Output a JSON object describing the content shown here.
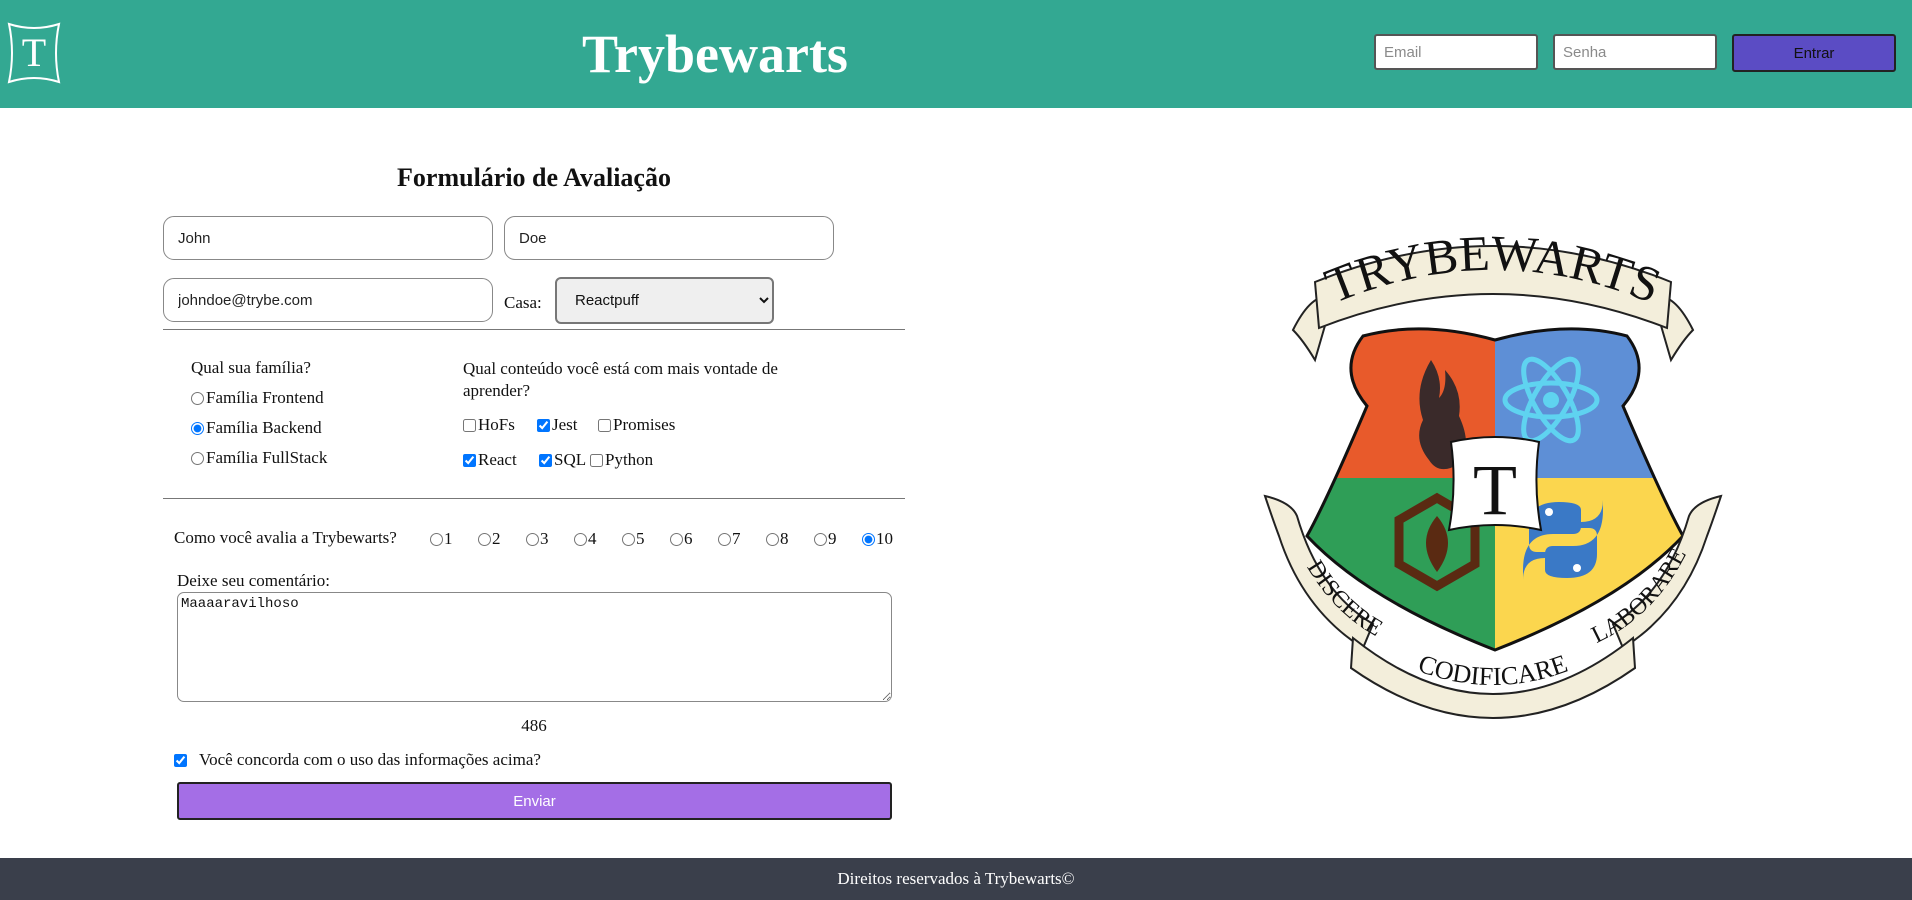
{
  "header": {
    "logo_letter": "T",
    "title": "Trybewarts",
    "email_placeholder": "Email",
    "password_placeholder": "Senha",
    "login_label": "Entrar"
  },
  "form": {
    "title": "Formulário de Avaliação",
    "first_name": "John",
    "last_name": "Doe",
    "email": "johndoe@trybe.com",
    "house_label": "Casa:",
    "house_selected": "Reactpuff",
    "family": {
      "question": "Qual sua família?",
      "options": [
        {
          "label": "Família Frontend",
          "checked": false
        },
        {
          "label": "Família Backend",
          "checked": true
        },
        {
          "label": "Família FullStack",
          "checked": false
        }
      ]
    },
    "content": {
      "question": "Qual conteúdo você está com mais vontade de aprender?",
      "options": [
        {
          "label": "HoFs",
          "checked": false
        },
        {
          "label": "Jest",
          "checked": true
        },
        {
          "label": "Promises",
          "checked": false
        },
        {
          "label": "React",
          "checked": true
        },
        {
          "label": "SQL",
          "checked": true
        },
        {
          "label": "Python",
          "checked": false
        }
      ]
    },
    "rating": {
      "question": "Como você avalia a Trybewarts?",
      "options": [
        "1",
        "2",
        "3",
        "4",
        "5",
        "6",
        "7",
        "8",
        "9",
        "10"
      ],
      "selected": "10"
    },
    "comment_label": "Deixe seu comentário:",
    "comment": "Maaaaravilhoso",
    "char_counter": "486",
    "agreement_label": "Você concorda com o uso das informações acima?",
    "agreement_checked": true,
    "submit_label": "Enviar"
  },
  "crest": {
    "banner_top": "TRYBEWARTS",
    "center_letter": "T",
    "motto_left": "DISCERE",
    "motto_bottom": "CODIFICARE",
    "motto_right": "LABORARE",
    "quarters": {
      "top_left": "fire-icon",
      "top_right": "react-atom-icon",
      "bottom_left": "hexagon-leaf-icon",
      "bottom_right": "python-icon"
    },
    "colors": {
      "top_left": "#e85a2b",
      "top_right": "#5e8fd6",
      "bottom_left": "#2f9e57",
      "bottom_right": "#fbd64e",
      "banner": "#f3eedb"
    }
  },
  "footer": {
    "text": "Direitos reservados à Trybewarts©"
  },
  "colors": {
    "header_bg": "#33a892",
    "login_button": "#5b4cc4",
    "submit_button": "#a46ee6",
    "footer_bg": "#3a3f4b"
  }
}
